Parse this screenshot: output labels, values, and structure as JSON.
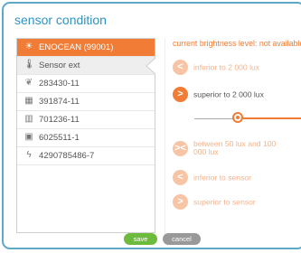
{
  "dialog": {
    "title": "sensor condition"
  },
  "devices": [
    {
      "label": "ENOCEAN (99001)",
      "icon": "sun-icon"
    },
    {
      "label": "Sensor ext",
      "icon": "thermometer-icon"
    },
    {
      "label": "283430-11",
      "icon": "leaf-icon"
    },
    {
      "label": "391874-11",
      "icon": "panel-icon"
    },
    {
      "label": "701236-11",
      "icon": "meter-icon"
    },
    {
      "label": "6025511-1",
      "icon": "plug-icon"
    },
    {
      "label": "4290785486-7",
      "icon": "lightning-icon"
    }
  ],
  "brightness_status": "current brightness level: not available",
  "options": {
    "inferior_2000": "inferior to 2 000 lux",
    "superior_2000": "superior to 2 000 lux",
    "between_50_100000": "between 50 lux and 100 000 lux",
    "inferior_sensor": "inferior to sensor",
    "superior_sensor": "superior to sensor"
  },
  "slider": {
    "level": 0.33
  },
  "buttons": {
    "save": "save",
    "cancel": "cancel"
  },
  "colors": {
    "accent": "#f07c35",
    "border": "#5ea9c8",
    "title": "#2f94c0",
    "save": "#6dbb3c",
    "cancel": "#999999"
  }
}
